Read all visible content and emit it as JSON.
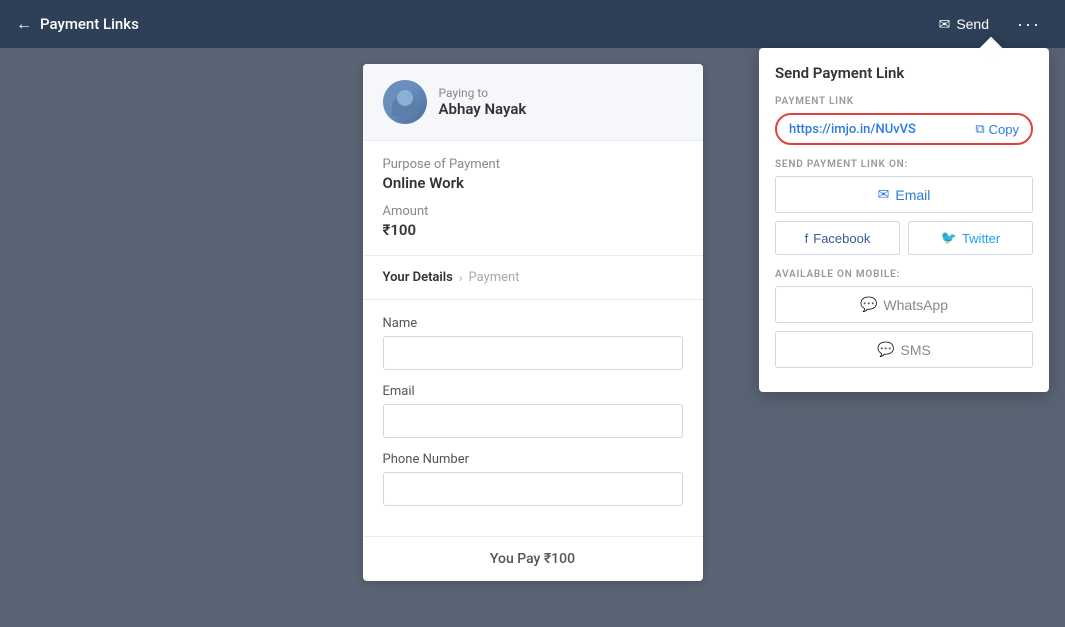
{
  "header": {
    "back_label": "Payment Links",
    "send_label": "Send",
    "more_label": "···"
  },
  "paying_to": {
    "label": "Paying to",
    "name": "Abhay Nayak"
  },
  "payment": {
    "purpose_label": "Purpose of Payment",
    "purpose_value": "Online Work",
    "amount_label": "Amount",
    "amount_value": "₹100"
  },
  "steps": {
    "your_details": "Your Details",
    "payment": "Payment"
  },
  "form": {
    "name_label": "Name",
    "name_placeholder": "",
    "email_label": "Email",
    "email_placeholder": "",
    "phone_label": "Phone Number",
    "phone_placeholder": ""
  },
  "footer": {
    "you_pay": "You Pay ₹100"
  },
  "send_panel": {
    "title": "Send Payment Link",
    "link_section_label": "PAYMENT LINK",
    "url": "https://imjo.in/NUvVS",
    "copy_label": "Copy",
    "send_on_label": "SEND PAYMENT LINK ON:",
    "email_btn": "Email",
    "facebook_btn": "Facebook",
    "twitter_btn": "Twitter",
    "mobile_label": "AVAILABLE ON MOBILE:",
    "whatsapp_btn": "WhatsApp",
    "sms_btn": "SMS"
  }
}
